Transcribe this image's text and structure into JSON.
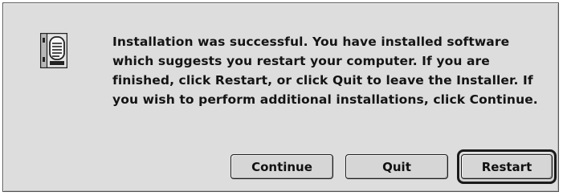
{
  "dialog": {
    "message": "Installation was successful. You have installed software which suggests you restart your computer. If you are finished, click Restart, or click Quit to leave the Installer. If you wish to perform additional installations, click Continue.",
    "icon": "alert-note-icon",
    "buttons": {
      "continue_label": "Continue",
      "quit_label": "Quit",
      "restart_label": "Restart"
    },
    "default_button": "Restart"
  },
  "colors": {
    "dialog_background": "#dddddd",
    "border": "#555555",
    "text": "#141414"
  }
}
